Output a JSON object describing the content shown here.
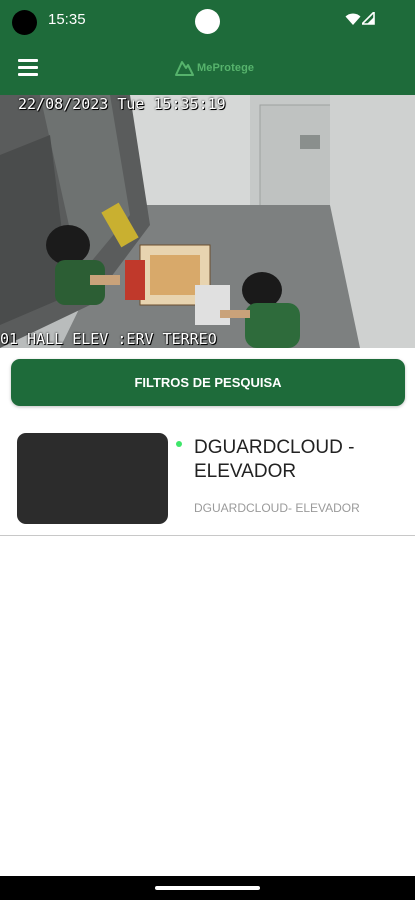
{
  "status_bar": {
    "time": "15:35",
    "icons": [
      "wifi-icon",
      "signal-icon"
    ]
  },
  "app_bar": {
    "menu_icon": "hamburger-menu-icon",
    "brand": "MeProtege",
    "brand_color": "#56b36c",
    "bar_color": "#1e6b3a"
  },
  "camera": {
    "timestamp": "22/08/2023 Tue 15:35:19",
    "label": "01 HALL ELEV :ERV TERREO"
  },
  "filter_button": {
    "label": "FILTROS DE PESQUISA"
  },
  "cameras_list": [
    {
      "title": "DGUARDCLOUD - ELEVADOR",
      "subtitle": "DGUARDCLOUD- ELEVADOR",
      "status": "online",
      "status_color": "#3ee66a"
    }
  ]
}
